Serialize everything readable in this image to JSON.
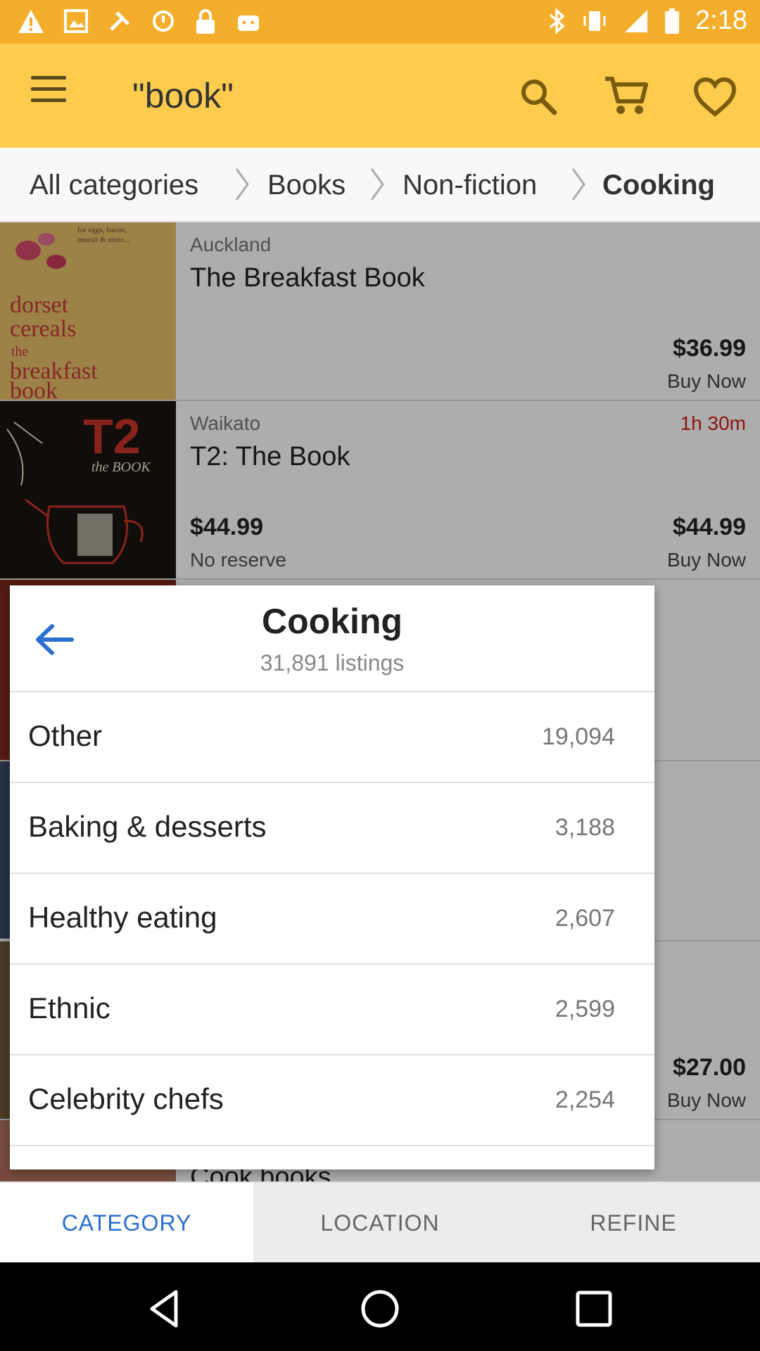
{
  "status_bar": {
    "time": "2:18",
    "left_icons": [
      "warning-icon",
      "image-icon",
      "tools-icon",
      "sync-icon",
      "lock-icon",
      "android-icon"
    ],
    "right_icons": [
      "bluetooth-icon",
      "vibrate-icon",
      "signal-icon",
      "battery-icon"
    ]
  },
  "app_bar": {
    "title": "\"book\"",
    "color": "#fdcc4e"
  },
  "breadcrumb": {
    "items": [
      "All categories",
      "Books",
      "Non-fiction",
      "Cooking"
    ]
  },
  "listings": [
    {
      "location": "Auckland",
      "title": "The Breakfast Book",
      "buy_price": "$36.99",
      "buy_label": "Buy Now",
      "thumb_text": [
        "for eggs, bacon,",
        "muesli & more...",
        "dorset",
        "cereals",
        "the",
        "breakfast",
        "book"
      ]
    },
    {
      "location": "Waikato",
      "title": "T2: The Book",
      "time_left": "1h 30m",
      "bid_price": "$44.99",
      "reserve": "No reserve",
      "buy_price": "$44.99",
      "buy_label": "Buy Now",
      "thumb_text": [
        "T2",
        "the BOOK"
      ]
    },
    {
      "buy_price": "$27.00",
      "buy_label": "Buy Now"
    },
    {
      "title_partial": "Cook books"
    }
  ],
  "dialog": {
    "title": "Cooking",
    "subtitle": "31,891 listings",
    "categories": [
      {
        "name": "Other",
        "count": "19,094"
      },
      {
        "name": "Baking & desserts",
        "count": "3,188"
      },
      {
        "name": "Healthy eating",
        "count": "2,607"
      },
      {
        "name": "Ethnic",
        "count": "2,599"
      },
      {
        "name": "Celebrity chefs",
        "count": "2,254"
      }
    ]
  },
  "tabs": {
    "category": "CATEGORY",
    "location": "LOCATION",
    "refine": "REFINE",
    "active_color": "#2b6fcf"
  }
}
